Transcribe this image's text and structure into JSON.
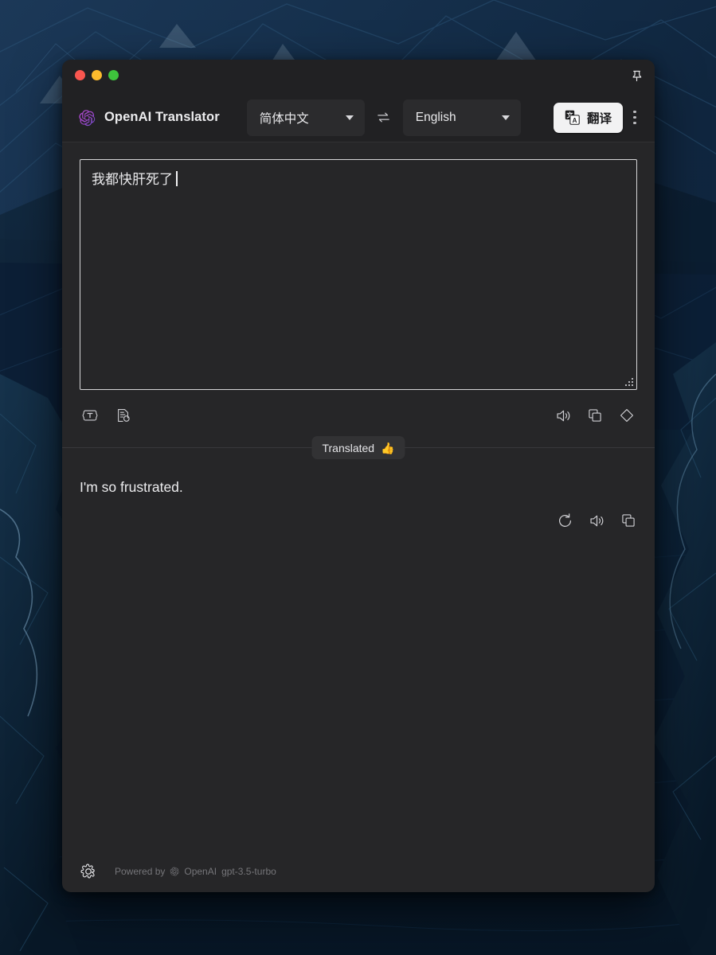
{
  "window": {
    "traffic_lights": [
      {
        "name": "close",
        "color": "#f9564f"
      },
      {
        "name": "minimize",
        "color": "#fcbb2d"
      },
      {
        "name": "maximize",
        "color": "#3ec33c"
      }
    ],
    "pin_icon": "pushpin-icon"
  },
  "header": {
    "app_title": "OpenAI Translator",
    "logo_icon": "openai-logo-icon",
    "source_language": "简体中文",
    "target_language": "English",
    "swap_icon": "swap-arrows-icon",
    "translate_button_label": "翻译",
    "translate_button_icon": "google-translate-icon",
    "menu_icon": "kebab-menu-icon"
  },
  "source": {
    "text": "我都快肝死了",
    "placeholder": "",
    "actions_left": [
      {
        "name": "ocr-capture-icon",
        "title": "OCR"
      },
      {
        "name": "document-scan-icon",
        "title": "Document"
      }
    ],
    "actions_right": [
      {
        "name": "speaker-icon",
        "title": "Speak"
      },
      {
        "name": "copy-icon",
        "title": "Copy"
      },
      {
        "name": "eraser-icon",
        "title": "Clear"
      }
    ]
  },
  "status": {
    "label": "Translated",
    "emoji": "👍"
  },
  "result": {
    "text": "I'm so frustrated.",
    "actions": [
      {
        "name": "refresh-icon",
        "title": "Retranslate"
      },
      {
        "name": "speaker-icon",
        "title": "Speak"
      },
      {
        "name": "copy-icon",
        "title": "Copy"
      }
    ]
  },
  "footer": {
    "settings_icon": "gear-icon",
    "powered_by": "Powered by",
    "provider": "OpenAI",
    "model": "gpt-3.5-turbo",
    "provider_icon": "openai-logo-icon"
  },
  "theme": {
    "window_bg": "#262628",
    "header_bg": "#212123",
    "accent_button_bg": "#f2f2f3",
    "text_primary": "#ececee",
    "text_muted": "#757579",
    "desktop_bg": "#0a1a2e"
  }
}
